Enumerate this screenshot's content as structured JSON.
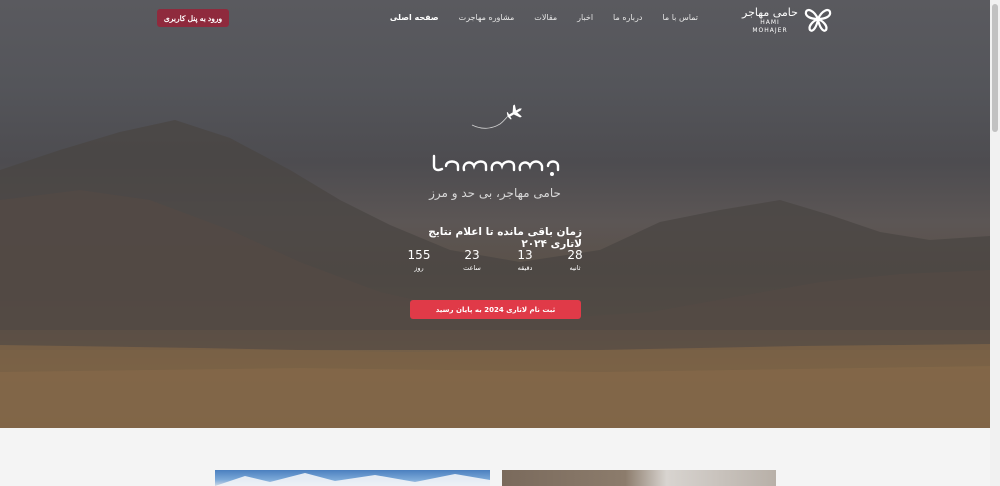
{
  "nav": {
    "logo_fa": "حامی مهاجر",
    "logo_en": "HAMI MOHAJER",
    "menu": [
      "صفحه اصلی",
      "مشاوره مهاجرت",
      "مقالات",
      "اخبار",
      "درباره ما",
      "تماس با ما"
    ],
    "login_label": "ورود به پنل کاربری"
  },
  "hero": {
    "brand": "حامی مهاجر",
    "tagline": "حامی مهاجر، بی حد و مرز",
    "countdown_title": "زمان باقی مانده تا اعلام نتایج لاتاری ۲۰۲۴",
    "countdown": [
      {
        "value": "28",
        "label": "ثانیه"
      },
      {
        "value": "13",
        "label": "دقیقه"
      },
      {
        "value": "23",
        "label": "ساعت"
      },
      {
        "value": "155",
        "label": "روز"
      }
    ],
    "cta_label": "ثبت نام لاتاری 2024 به پایان رسید"
  },
  "colors": {
    "login_button": "#8f2a3d",
    "cta_button": "#e03a48"
  },
  "icons": [
    "butterfly-logo-icon",
    "airplane-icon"
  ]
}
